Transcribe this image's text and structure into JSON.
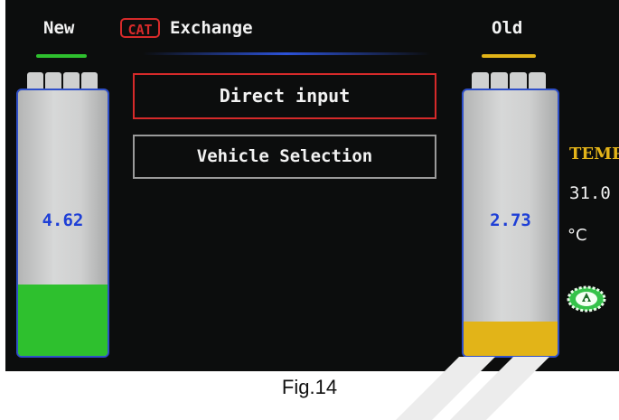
{
  "header": {
    "new_label": "New",
    "cat_badge": "CAT",
    "title": "Exchange",
    "old_label": "Old"
  },
  "menu": {
    "direct_input": "Direct input",
    "vehicle_selection": "Vehicle Selection"
  },
  "batteries": {
    "new": {
      "value": "4.62",
      "fill_fraction": 0.27,
      "fill_color": "#2ec02e"
    },
    "old": {
      "value": "2.73",
      "fill_fraction": 0.13,
      "fill_color": "#e2b418"
    }
  },
  "temperature": {
    "label": "TEMP",
    "value": "31.0",
    "unit": "°C"
  },
  "caption": "Fig.14",
  "colors": {
    "screen_bg": "#0c0d0d",
    "new_tab": "#2ec02e",
    "old_tab": "#e2b418",
    "selected_border": "#d62a2a",
    "battery_border": "#2f4fc8",
    "temp_label": "#e4b419"
  },
  "icons": {
    "status_icon": "green-gear-icon",
    "cat_badge": "cat-badge-icon"
  }
}
